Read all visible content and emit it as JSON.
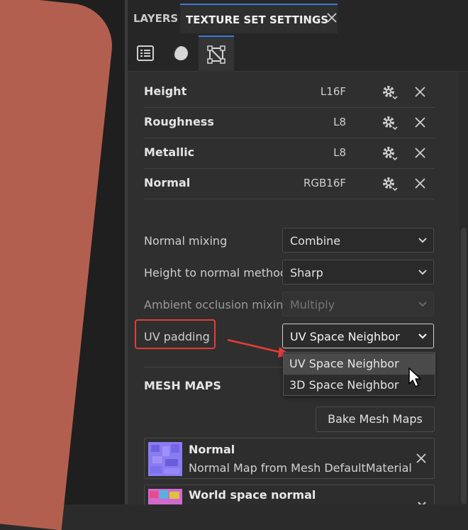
{
  "tabs": [
    {
      "label": "LAYERS",
      "active": false
    },
    {
      "label": "TEXTURE SET SETTINGS",
      "active": true
    }
  ],
  "subtabs": [
    {
      "icon": "texture-list-icon"
    },
    {
      "icon": "material-sphere-icon"
    },
    {
      "icon": "uv-square-icon",
      "active": true
    }
  ],
  "channels": [
    {
      "name": "Height",
      "format": "L16F"
    },
    {
      "name": "Roughness",
      "format": "L8"
    },
    {
      "name": "Metallic",
      "format": "L8"
    },
    {
      "name": "Normal",
      "format": "RGB16F"
    }
  ],
  "properties": {
    "normal_mixing": {
      "label": "Normal mixing",
      "value": "Combine"
    },
    "height_to_normal": {
      "label": "Height to normal method",
      "value": "Sharp"
    },
    "ao_mixing": {
      "label": "Ambient occlusion mixing",
      "value": "Multiply",
      "disabled": true
    },
    "uv_padding": {
      "label": "UV padding",
      "value": "UV Space Neighbor"
    }
  },
  "uv_padding_options": [
    "UV Space Neighbor",
    "3D Space Neighbor"
  ],
  "mesh_maps": {
    "title": "MESH MAPS",
    "bake_label": "Bake Mesh Maps",
    "items": [
      {
        "title": "Normal",
        "description": "Normal Map from Mesh DefaultMaterial"
      },
      {
        "title": "World space normal",
        "description": ""
      }
    ]
  },
  "colors": {
    "accent": "#3b78d8",
    "annotation_red": "#e53b3b",
    "viewport_mesh": "#b35f4f"
  }
}
